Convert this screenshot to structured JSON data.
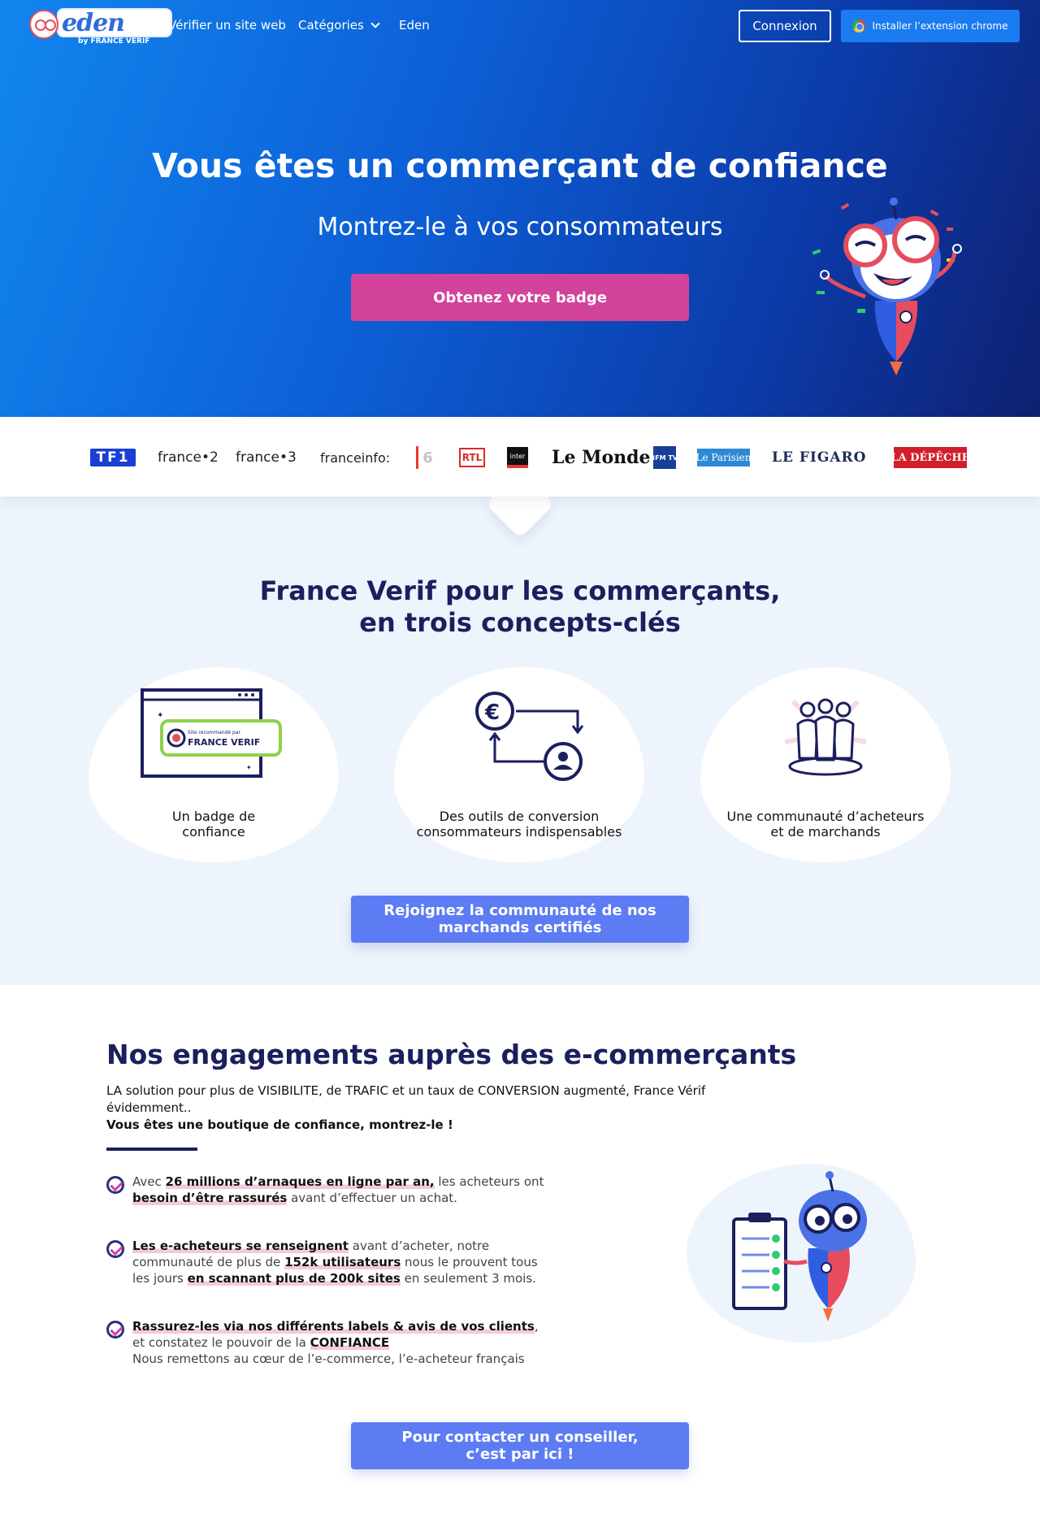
{
  "header": {
    "logo_word": "eden",
    "logo_sub": "by FRANCE VERIF",
    "nav": {
      "verify": "Vérifier un site web",
      "categories": "Catégories",
      "eden": "Eden"
    },
    "login_label": "Connexion",
    "chrome_label": "Installer l’extension chrome"
  },
  "hero": {
    "title": "Vous êtes un commerçant de confiance",
    "subtitle": "Montrez-le à vos consommateurs",
    "cta": "Obtenez votre badge"
  },
  "press": {
    "tf1": "TF1",
    "france2": "france•2",
    "france3": "france•3",
    "franceinfo": "franceinfo:",
    "m6": "6",
    "rtl": "RTL",
    "inter": "inter",
    "lemonde": "Le Monde",
    "bfm": "BFM TV.",
    "parisien": "Le Parisien",
    "figaro": "LE FIGARO",
    "depeche": "LA DÉPÊCHE"
  },
  "concepts": {
    "title_line1": "France Verif pour les commerçants,",
    "title_line2": "en trois concepts-clés",
    "badge_small": "Site recommandé par",
    "badge_brand": "FRANCE VERIF",
    "cards": [
      {
        "label_line1": "Un badge de",
        "label_line2": "confiance"
      },
      {
        "label_line1": "Des outils de conversion",
        "label_line2": "consommateurs indispensables"
      },
      {
        "label_line1": "Une communauté d’acheteurs",
        "label_line2": "et de marchands"
      }
    ],
    "cta_line1": "Rejoignez la communauté de nos",
    "cta_line2": "marchands certifiés"
  },
  "engagements": {
    "title": "Nos engagements auprès des e-commerçants",
    "intro": "LA solution pour plus de VISIBILITE, de TRAFIC et un taux de CONVERSION augmenté, France Vérif évidemment..",
    "intro_strong": "Vous êtes une boutique de confiance, montrez-le !",
    "items": [
      {
        "p1": "Avec ",
        "b1": "26 millions d’arnaques en ligne par an,",
        "p2": " les acheteurs ont ",
        "b2": "besoin d’être rassurés",
        "p3": " avant d’effectuer un achat."
      },
      {
        "b1": "Les e-acheteurs se renseignent",
        "p1": " avant d’acheter, notre communauté de plus de ",
        "b2": "152k utilisateurs",
        "p2": " nous le prouvent tous les jours ",
        "b3": "en scannant plus de 200k sites",
        "p3": " en seulement 3 mois."
      },
      {
        "b1": "Rassurez-les via nos différents labels & avis de vos clients",
        "p1": ", et constatez le pouvoir de la ",
        "b2": "CONFIANCE",
        "p2": "Nous remettons au cœur de l’e-commerce, l’e-acheteur français"
      }
    ],
    "cta_line1": "Pour contacter un conseiller,",
    "cta_line2": "c’est par ici !"
  },
  "colors": {
    "hero_start": "#1186ee",
    "hero_end": "#0f2070",
    "pink_cta": "#d3439b",
    "blue_cta": "#5d7cf3",
    "navy_text": "#1b1f5e",
    "section_bg": "#edf4fc"
  },
  "icons": [
    "robot-mascot-icon",
    "chrome-icon",
    "chevron-down-icon",
    "euro-icon",
    "user-icon",
    "community-icon",
    "checklist-icon",
    "check-circle-icon"
  ]
}
